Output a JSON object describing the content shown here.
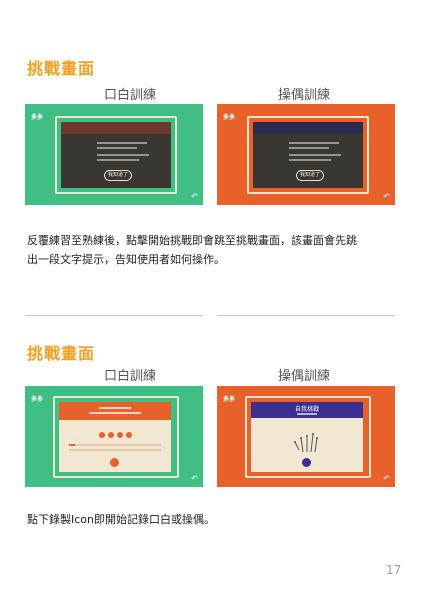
{
  "section1": {
    "title": "挑戰畫面",
    "col_left": "口白訓練",
    "col_right": "操偶訓練",
    "left_thumb": {
      "logo": "多多",
      "button": "我知道了"
    },
    "right_thumb": {
      "logo": "多多",
      "button": "我知道了"
    },
    "description_line1": "反覆練習至熟練後，點擊開始挑戰即會跳至挑戰畫面，該畫面會先跳",
    "description_line2": "出一段文字提示，告知使用者如何操作。"
  },
  "section2": {
    "title": "挑戰畫面",
    "col_left": "口白訓練",
    "col_right": "操偶訓練",
    "left_thumb": {
      "logo": "多多"
    },
    "right_thumb": {
      "logo": "多多",
      "header": "自我挑戰"
    },
    "description": "點下錄製Icon即開始記錄口白或操偶。"
  },
  "page_number": "17",
  "colors": {
    "accent": "#f0a225",
    "green": "#3fbf84",
    "orange": "#e8612b",
    "navy": "#3b2f8f",
    "cream": "#f2e7d2"
  }
}
